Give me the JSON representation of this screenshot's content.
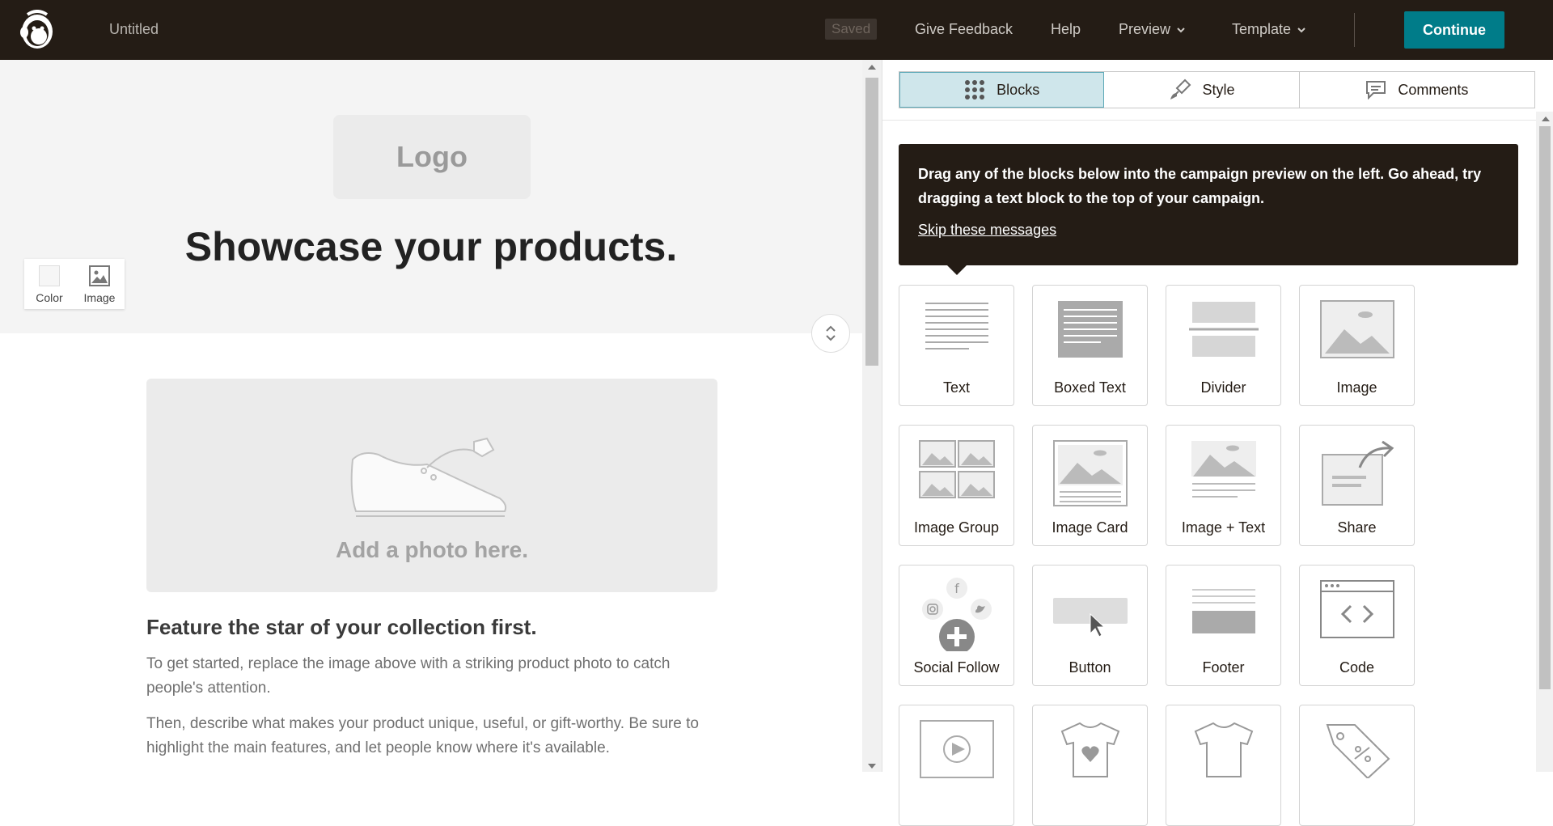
{
  "topbar": {
    "title": "Untitled",
    "saved_label": "Saved",
    "feedback_label": "Give Feedback",
    "help_label": "Help",
    "preview_label": "Preview",
    "template_label": "Template",
    "continue_label": "Continue",
    "logo_icon": "mailchimp-freddie-icon"
  },
  "preview": {
    "logo_placeholder": "Logo",
    "hero_title": "Showcase your products.",
    "bg_tools": {
      "color_label": "Color",
      "image_label": "Image"
    },
    "photo_placeholder": "Add a photo here.",
    "section_title": "Feature the star of your collection first.",
    "para1": "To get started, replace the image above with a striking product photo to catch people's attention.",
    "para2": "Then, describe what makes your product unique, useful, or gift-worthy. Be sure to highlight the main features, and let people know where it's available."
  },
  "panel": {
    "tabs": [
      {
        "label": "Blocks",
        "icon": "grid-icon",
        "active": true
      },
      {
        "label": "Style",
        "icon": "brush-icon",
        "active": false
      },
      {
        "label": "Comments",
        "icon": "comment-icon",
        "active": false
      }
    ],
    "tip_text": "Drag any of the blocks below into the campaign preview on the left. Go ahead, try dragging a text block to the top of your campaign.",
    "tip_link": "Skip these messages",
    "blocks": [
      {
        "label": "Text",
        "icon": "text-block-icon"
      },
      {
        "label": "Boxed Text",
        "icon": "boxed-text-icon"
      },
      {
        "label": "Divider",
        "icon": "divider-icon"
      },
      {
        "label": "Image",
        "icon": "image-block-icon"
      },
      {
        "label": "Image Group",
        "icon": "image-group-icon"
      },
      {
        "label": "Image Card",
        "icon": "image-card-icon"
      },
      {
        "label": "Image + Text",
        "icon": "image-text-icon"
      },
      {
        "label": "Share",
        "icon": "share-icon"
      },
      {
        "label": "Social Follow",
        "icon": "social-follow-icon"
      },
      {
        "label": "Button",
        "icon": "button-block-icon"
      },
      {
        "label": "Footer",
        "icon": "footer-icon"
      },
      {
        "label": "Code",
        "icon": "code-icon"
      },
      {
        "label": "",
        "icon": "video-icon"
      },
      {
        "label": "",
        "icon": "product-heart-icon"
      },
      {
        "label": "",
        "icon": "product-icon"
      },
      {
        "label": "",
        "icon": "promo-code-icon"
      }
    ]
  },
  "colors": {
    "topbar_bg": "#241c15",
    "accent": "#007c89",
    "active_tab": "#cfe6eb"
  }
}
